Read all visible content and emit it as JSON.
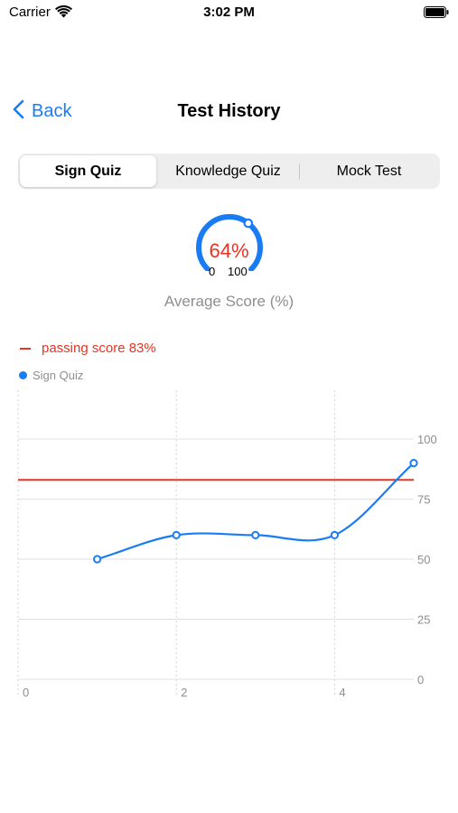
{
  "status_bar": {
    "carrier": "Carrier",
    "time": "3:02 PM"
  },
  "nav": {
    "back_label": "Back",
    "title": "Test History"
  },
  "tabs": [
    {
      "label": "Sign Quiz",
      "selected": true
    },
    {
      "label": "Knowledge Quiz",
      "selected": false
    },
    {
      "label": "Mock Test",
      "selected": false
    }
  ],
  "gauge": {
    "value": 64,
    "value_label": "64%",
    "min_label": "0",
    "max_label": "100",
    "caption": "Average Score (%)"
  },
  "legend": {
    "passing_label": "passing score 83%",
    "series_label": "Sign Quiz"
  },
  "colors": {
    "accent": "#1a7cf5",
    "passing": "#ea3323",
    "grid": "#e0e0e0",
    "label": "#8e8e93"
  },
  "chart_data": {
    "type": "line",
    "x_ticks": [
      "0",
      "2",
      "4"
    ],
    "y_ticks": [
      "0",
      "25",
      "50",
      "75",
      "100"
    ],
    "xlim": [
      0,
      5
    ],
    "ylim": [
      0,
      100
    ],
    "passing_score": 83,
    "series": [
      {
        "name": "Sign Quiz",
        "x": [
          1,
          2,
          3,
          4,
          5
        ],
        "y": [
          50,
          60,
          60,
          60,
          90
        ]
      }
    ]
  }
}
